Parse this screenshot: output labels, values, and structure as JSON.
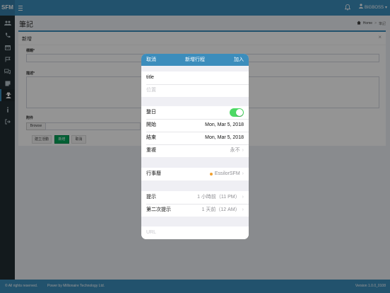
{
  "app": {
    "logo": "SFM",
    "user": "BIGBOSS",
    "colors": {
      "primary": "#3c8dbc",
      "sidebar": "#222d32",
      "success": "#00a65a",
      "toggle_on": "#4cd964",
      "calendar_dot": "#f0a030"
    }
  },
  "page": {
    "title": "筆記",
    "breadcrumb": {
      "home": "Home",
      "separator": ">",
      "current": "筆記"
    }
  },
  "sidebar": {
    "icons": [
      "users-icon",
      "phone-icon",
      "calendar-icon",
      "flag-icon",
      "chat-icon",
      "note-icon",
      "user-secret-icon",
      "info-icon",
      "logout-icon"
    ],
    "active": "user-secret-icon"
  },
  "form": {
    "box_title": "新增",
    "close_label": "×",
    "theme_label": "標題*",
    "desc_label": "描述*",
    "attachment_label": "附件",
    "browse_label": "Browse",
    "buttons": {
      "create_activity": "建立活動",
      "add": "新增",
      "cancel": "取消"
    }
  },
  "modal": {
    "cancel_label": "取消",
    "title": "新增行程",
    "add_label": "加入",
    "title_value": "title",
    "location_placeholder": "位置",
    "all_day": {
      "label": "整日",
      "value": true
    },
    "start": {
      "label": "開始",
      "value": "Mon, Mar 5, 2018"
    },
    "end": {
      "label": "結束",
      "value": "Mon, Mar 5, 2018"
    },
    "repeat": {
      "label": "重複",
      "value": "永不"
    },
    "calendar": {
      "label": "行事曆",
      "value": "EssilorSFM"
    },
    "alert": {
      "label": "提示",
      "value": "1 小時前（11 PM）"
    },
    "second_alert": {
      "label": "第二次提示",
      "value": "1 天前（12 AM）"
    },
    "url_placeholder": "URL"
  },
  "footer": {
    "copyright": "© All rights reserved.",
    "powered": "Power by Millionaire Technology Ltd.",
    "version": "Version 1.0.0_0108"
  }
}
